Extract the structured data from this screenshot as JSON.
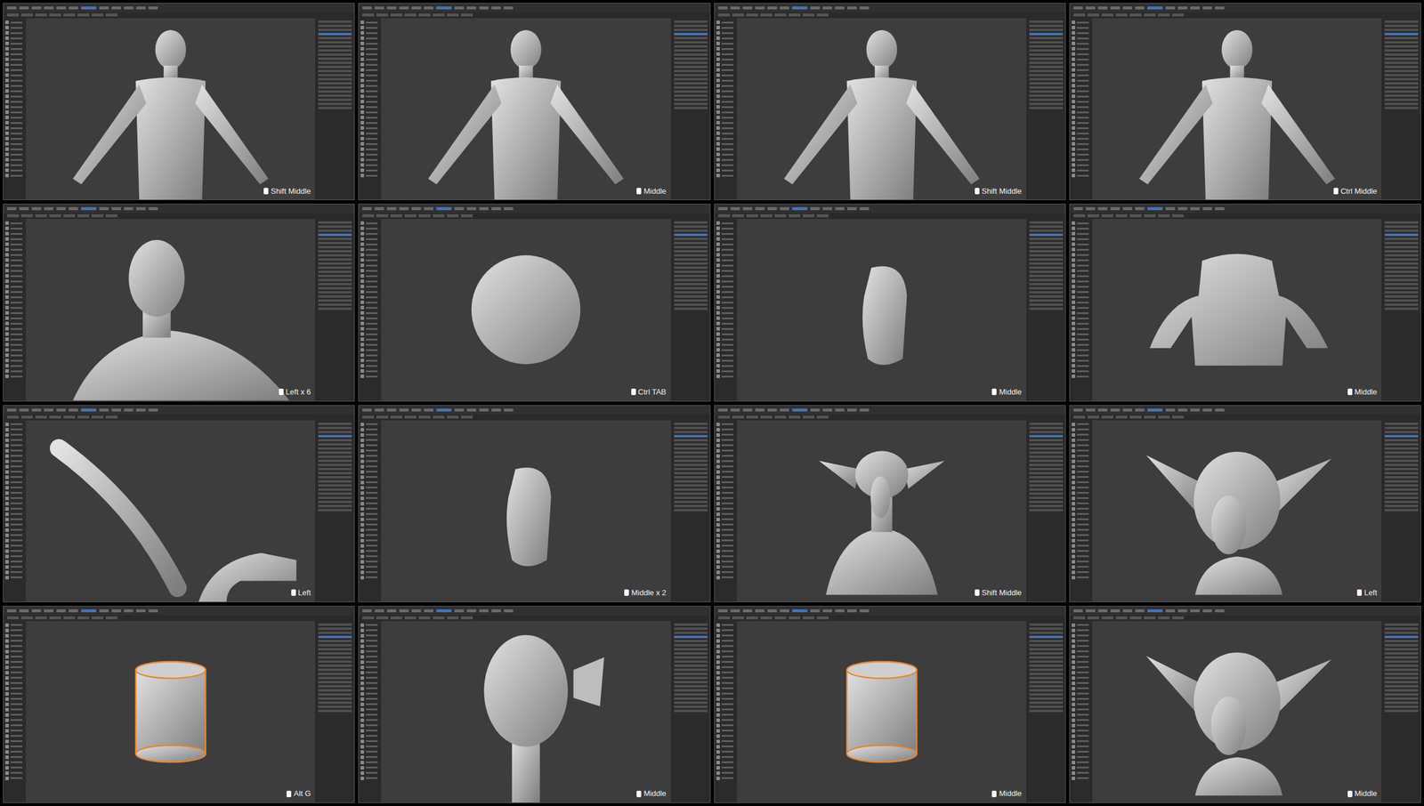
{
  "tiles": [
    {
      "key": "Shift Middle",
      "kind": "human"
    },
    {
      "key": "Middle",
      "kind": "human"
    },
    {
      "key": "Shift Middle",
      "kind": "human"
    },
    {
      "key": "Ctrl Middle",
      "kind": "human"
    },
    {
      "key": "Left x 6",
      "kind": "bust"
    },
    {
      "key": "Ctrl TAB",
      "kind": "sphere"
    },
    {
      "key": "Middle",
      "kind": "head"
    },
    {
      "key": "Middle",
      "kind": "torso"
    },
    {
      "key": "Left",
      "kind": "limb"
    },
    {
      "key": "Middle x 2",
      "kind": "head"
    },
    {
      "key": "Shift Middle",
      "kind": "goblin"
    },
    {
      "key": "Left",
      "kind": "goblinhead"
    },
    {
      "key": "Alt G",
      "kind": "cylinder"
    },
    {
      "key": "Middle",
      "kind": "egg"
    },
    {
      "key": "Middle",
      "kind": "cylinder"
    },
    {
      "key": "Middle",
      "kind": "goblinhead"
    }
  ]
}
